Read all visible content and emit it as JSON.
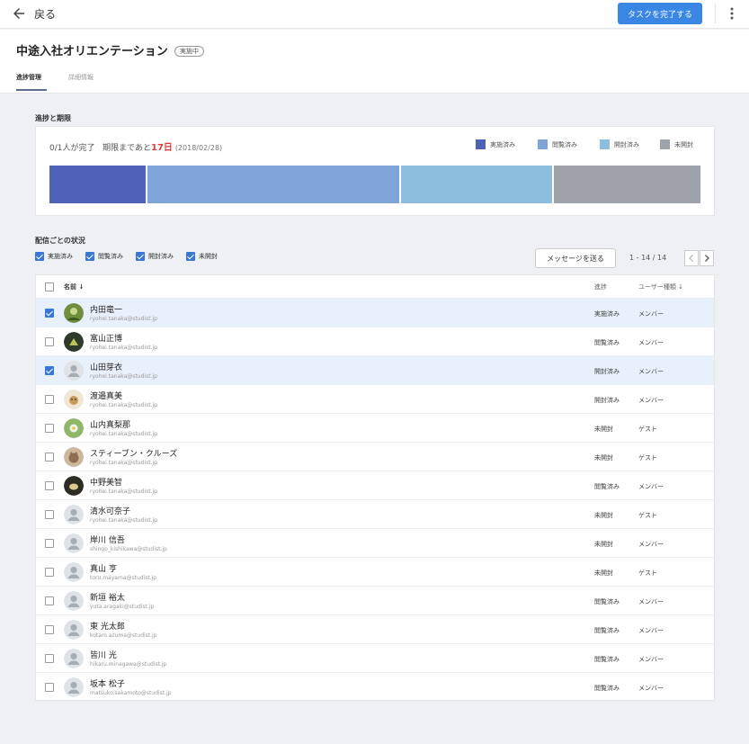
{
  "topbar": {
    "back_label": "戻る",
    "complete_button": "タスクを完了する"
  },
  "header": {
    "title": "中途入社オリエンテーション",
    "badge": "実施中",
    "tabs": [
      {
        "label": "進捗管理",
        "active": true
      },
      {
        "label": "詳細情報",
        "active": false
      }
    ]
  },
  "progress": {
    "section_title": "進捗と期限",
    "completed_text": "0/1人が完了",
    "deadline_prefix": "期限まであと",
    "days_left": "17日",
    "deadline_date": "(2018/02/28)",
    "legend": [
      {
        "label": "実施済み",
        "color": "#4e63b8"
      },
      {
        "label": "閲覧済み",
        "color": "#7ea4d8"
      },
      {
        "label": "開封済み",
        "color": "#8ebedd"
      },
      {
        "label": "未開封",
        "color": "#9ea3ab"
      }
    ],
    "segments": [
      {
        "status": "実施済み",
        "fraction": 0.15,
        "color": "#4e63b8"
      },
      {
        "status": "閲覧済み",
        "fraction": 0.39,
        "color": "#7ea4d8"
      },
      {
        "status": "開封済み",
        "fraction": 0.235,
        "color": "#8ebedd"
      },
      {
        "status": "未開封",
        "fraction": 0.225,
        "color": "#9ea3ab"
      }
    ]
  },
  "delivery": {
    "section_title": "配信ごとの状況",
    "filters": [
      {
        "label": "実施済み",
        "checked": true
      },
      {
        "label": "閲覧済み",
        "checked": true
      },
      {
        "label": "開封済み",
        "checked": true
      },
      {
        "label": "未開封",
        "checked": true
      }
    ],
    "send_message_button": "メッセージを送る",
    "pager_text": "1 - 14 / 14"
  },
  "table": {
    "headers": {
      "name": "名前",
      "status": "進捗",
      "type": "ユーザー種類"
    },
    "rows": [
      {
        "name": "内田竜一",
        "email": "ryohei.tanaka@studist.jp",
        "status": "実施済み",
        "type": "メンバー",
        "checked": true,
        "avatar": "photo-green"
      },
      {
        "name": "富山正博",
        "email": "ryohei.tanaka@studist.jp",
        "status": "閲覧済み",
        "type": "メンバー",
        "checked": false,
        "avatar": "photo-dark"
      },
      {
        "name": "山田芽衣",
        "email": "ryohei.tanaka@studist.jp",
        "status": "開封済み",
        "type": "メンバー",
        "checked": true,
        "avatar": "default"
      },
      {
        "name": "渡邉真美",
        "email": "ryohei.tanaka@studist.jp",
        "status": "開封済み",
        "type": "メンバー",
        "checked": false,
        "avatar": "photo-dog"
      },
      {
        "name": "山内真梨那",
        "email": "ryohei.tanaka@studist.jp",
        "status": "未開封",
        "type": "ゲスト",
        "checked": false,
        "avatar": "photo-flower"
      },
      {
        "name": "スティーブン・クルーズ",
        "email": "ryohei.tanaka@studist.jp",
        "status": "未開封",
        "type": "ゲスト",
        "checked": false,
        "avatar": "photo-cat"
      },
      {
        "name": "中野美智",
        "email": "ryohei.tanaka@studist.jp",
        "status": "閲覧済み",
        "type": "メンバー",
        "checked": false,
        "avatar": "photo-bird"
      },
      {
        "name": "清水可奈子",
        "email": "ryohei.tanaka@studist.jp",
        "status": "未開封",
        "type": "ゲスト",
        "checked": false,
        "avatar": "default"
      },
      {
        "name": "岸川 信吾",
        "email": "shingo_kishikawa@studist.jp",
        "status": "未開封",
        "type": "メンバー",
        "checked": false,
        "avatar": "default"
      },
      {
        "name": "真山 亨",
        "email": "toru.mayama@studist.jp",
        "status": "未開封",
        "type": "ゲスト",
        "checked": false,
        "avatar": "default"
      },
      {
        "name": "新垣 裕太",
        "email": "yuta.aragaki@studist.jp",
        "status": "閲覧済み",
        "type": "メンバー",
        "checked": false,
        "avatar": "default"
      },
      {
        "name": "東 光太郎",
        "email": "kotaro.azuma@studist.jp",
        "status": "閲覧済み",
        "type": "メンバー",
        "checked": false,
        "avatar": "default"
      },
      {
        "name": "皆川 光",
        "email": "hikaru.minagawa@studist.jp",
        "status": "閲覧済み",
        "type": "メンバー",
        "checked": false,
        "avatar": "default"
      },
      {
        "name": "坂本 松子",
        "email": "matsuko.sakamoto@studist.jp",
        "status": "閲覧済み",
        "type": "メンバー",
        "checked": false,
        "avatar": "default"
      }
    ]
  }
}
